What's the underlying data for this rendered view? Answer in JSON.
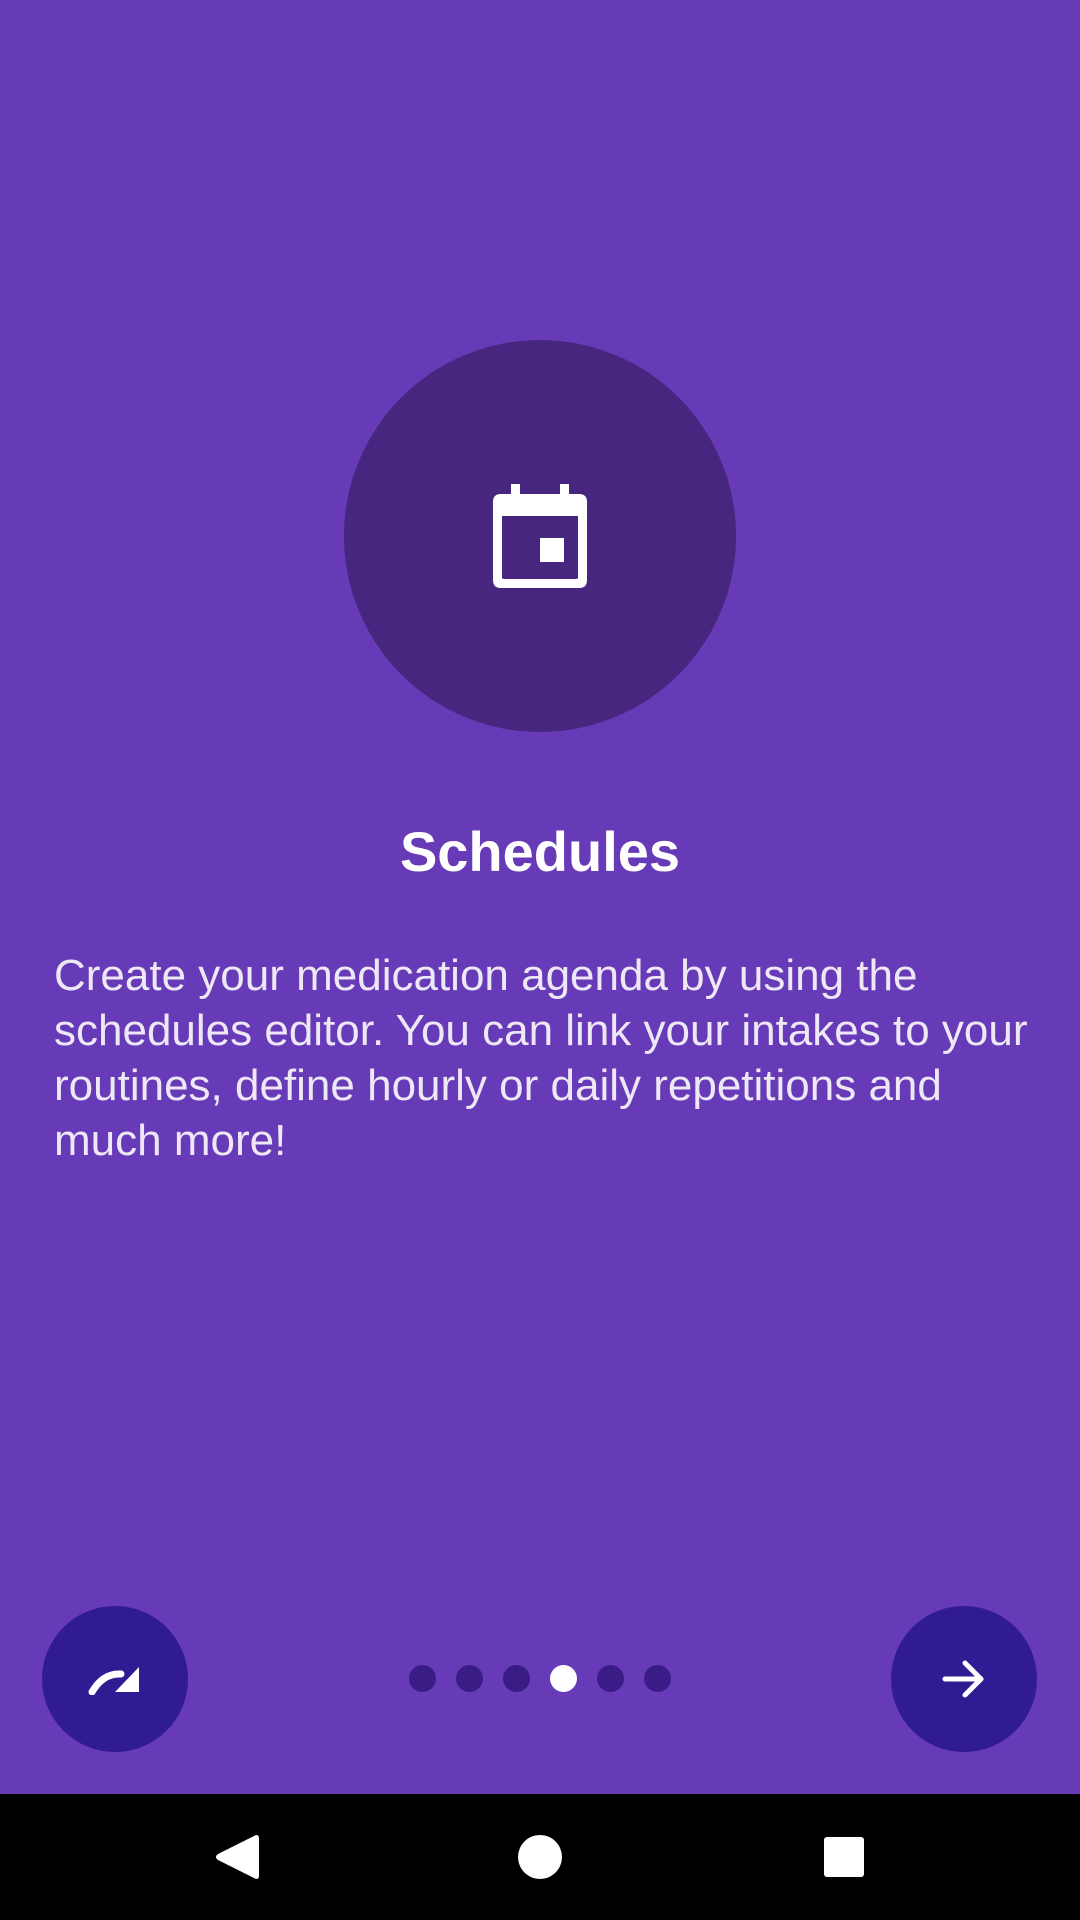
{
  "screen": {
    "title": "Schedules",
    "description": "Create your medication agenda by using the schedules editor. You can link your intakes to your routines, define hourly or daily repetitions and much more!",
    "hero_icon": "calendar-icon"
  },
  "pager": {
    "total": 6,
    "current_index": 3
  },
  "controls": {
    "skip_icon": "redo-icon",
    "next_icon": "arrow-forward-icon"
  },
  "system_nav": {
    "back_icon": "back-triangle-icon",
    "home_icon": "home-circle-icon",
    "recents_icon": "recents-square-icon"
  },
  "colors": {
    "background": "#673ab7",
    "hero_circle": "#47267f",
    "fab": "#311b92",
    "dot_inactive": "#3a1c86",
    "dot_active": "#ffffff"
  }
}
